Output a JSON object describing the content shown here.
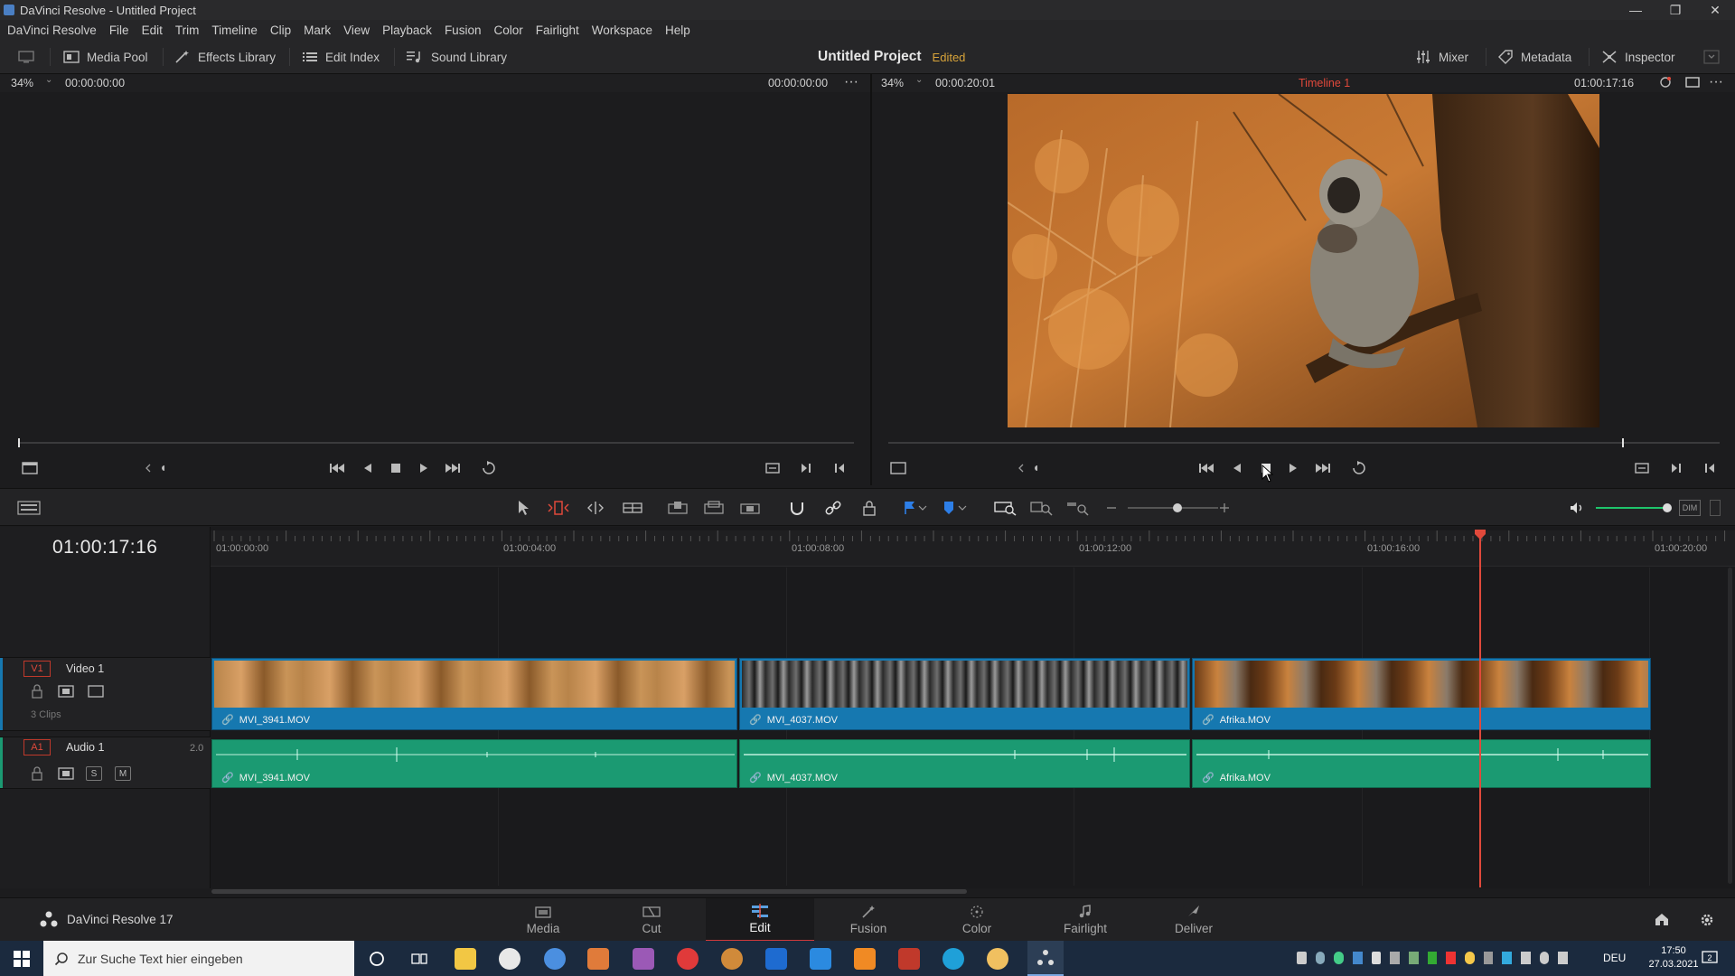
{
  "window": {
    "title": "DaVinci Resolve - Untitled Project"
  },
  "menu": [
    "DaVinci Resolve",
    "File",
    "Edit",
    "Trim",
    "Timeline",
    "Clip",
    "Mark",
    "View",
    "Playback",
    "Fusion",
    "Color",
    "Fairlight",
    "Workspace",
    "Help"
  ],
  "toolbar": {
    "media_pool": "Media Pool",
    "effects_library": "Effects Library",
    "edit_index": "Edit Index",
    "sound_library": "Sound Library",
    "project_title": "Untitled Project",
    "edited": "Edited",
    "mixer": "Mixer",
    "metadata": "Metadata",
    "inspector": "Inspector"
  },
  "source_viewer": {
    "zoom": "34%",
    "timecode_left": "00:00:00:00",
    "timecode_right": "00:00:00:00"
  },
  "program_viewer": {
    "zoom": "34%",
    "duration": "00:00:20:01",
    "timeline_name": "Timeline 1",
    "timecode": "01:00:17:16"
  },
  "timeline": {
    "current_timecode": "01:00:17:16",
    "ruler": [
      "01:00:00:00",
      "01:00:04:00",
      "01:00:08:00",
      "01:00:12:00",
      "01:00:16:00",
      "01:00:20:00"
    ],
    "video_track": {
      "id": "V1",
      "name": "Video 1",
      "clip_count": "3 Clips"
    },
    "audio_track": {
      "id": "A1",
      "name": "Audio 1",
      "channels": "2.0",
      "solo": "S",
      "mute": "M"
    },
    "video_clips": [
      "MVI_3941.MOV",
      "MVI_4037.MOV",
      "Afrika.MOV"
    ],
    "audio_clips": [
      "MVI_3941.MOV",
      "MVI_4037.MOV",
      "Afrika.MOV"
    ],
    "dim": "DIM"
  },
  "pages": {
    "brand": "DaVinci Resolve 17",
    "tabs": [
      "Media",
      "Cut",
      "Edit",
      "Fusion",
      "Color",
      "Fairlight",
      "Deliver"
    ],
    "active": "Edit"
  },
  "taskbar": {
    "search_placeholder": "Zur Suche Text hier eingeben",
    "language": "DEU",
    "time": "17:50",
    "date": "27.03.2021"
  },
  "colors": {
    "video_clip": "#1678b0",
    "audio_clip": "#1b9a72",
    "playhead": "#e0493b",
    "timeline_name": "#e0493b",
    "edited": "#d8a43a"
  }
}
